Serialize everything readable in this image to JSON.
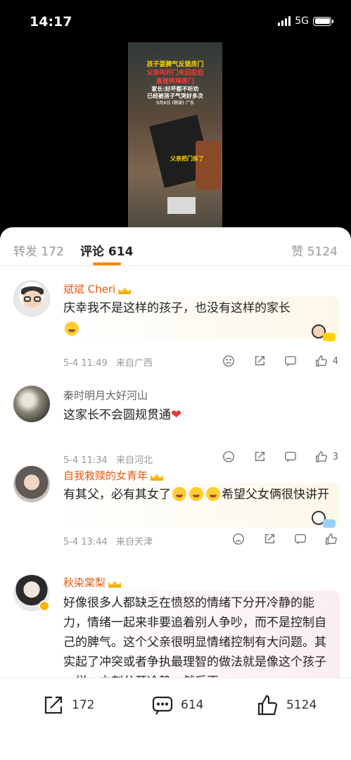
{
  "status_bar": {
    "time": "14:17",
    "network": "5G"
  },
  "video": {
    "caption_line1": "孩子耍脾气反锁房门",
    "caption_line2": "父亲叫开门未回应后",
    "caption_line3": "直接拆掉房门",
    "caption_line4": "家长:好坏都不听劝",
    "caption_line5": "已经被孩子气哭好多次",
    "caption_line6": "5月6日 (杨波) 广东",
    "in_video_label": "父亲把门拆了"
  },
  "tabs": {
    "repost_label": "转发 172",
    "comment_label": "评论 614",
    "like_label": "赞 5124"
  },
  "comments": [
    {
      "user": "斌斌 Cheri",
      "text": "庆幸我不是这样的孩子，也没有这样的家长",
      "time": "5-4 11:49",
      "location": "来自广西",
      "likes": "4"
    },
    {
      "user": "秦时明月大好河山",
      "text": "这家长不会圆规贯通",
      "time": "5-4 11:34",
      "location": "来自河北",
      "likes": "3"
    },
    {
      "user": "自我救赎的女青年",
      "text_part1": "有其父，必有其女了",
      "text_part2": "希望父女俩很快讲开",
      "time": "5-4 13:44",
      "location": "来自天津",
      "likes": ""
    },
    {
      "user": "秋染棠梨",
      "text": "好像很多人都缺乏在愤怒的情绪下分开冷静的能力，情绪一起来非要追着别人争吵，而不是控制自己的脾气。这个父亲很明显情绪控制有大问题。其实起了冲突或者争执最理智的做法就是像这个孩子一样，立刻分开冷静，然后再"
    }
  ],
  "bottom_bar": {
    "repost_count": "172",
    "comment_count": "614",
    "like_count": "5124"
  },
  "colors": {
    "accent": "#ff8200",
    "vip_name": "#e8590c"
  }
}
